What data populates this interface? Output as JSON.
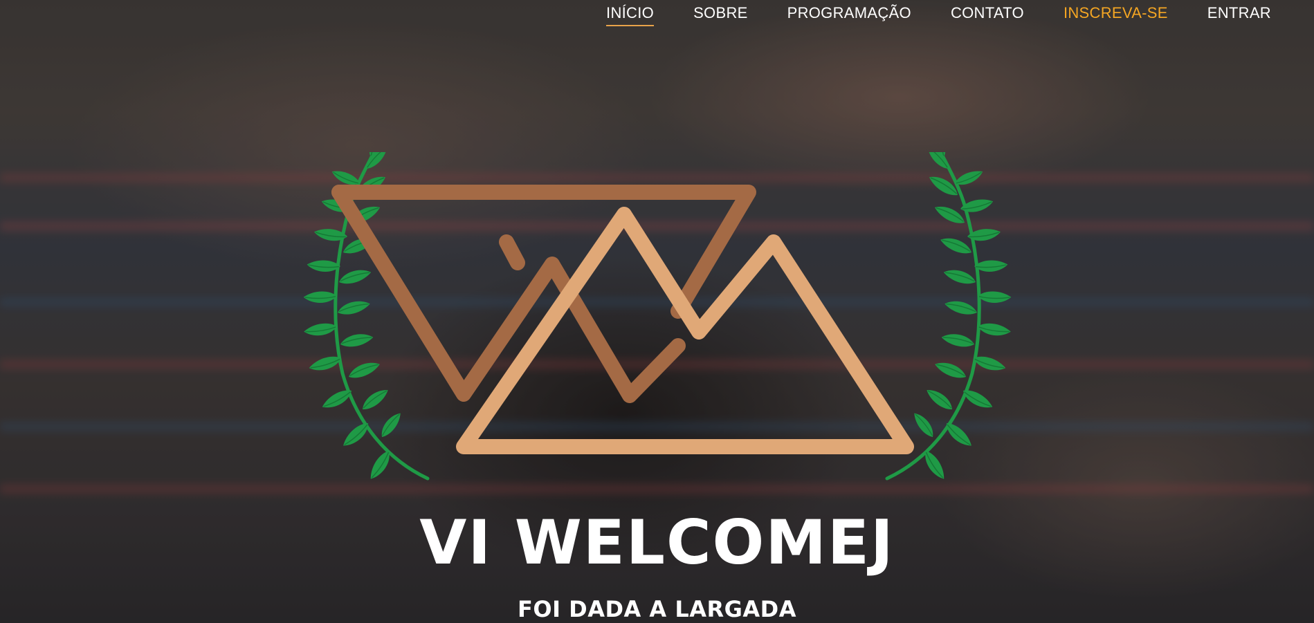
{
  "nav": {
    "items": [
      {
        "label": "INÍCIO"
      },
      {
        "label": "SOBRE"
      },
      {
        "label": "PROGRAMAÇÃO"
      },
      {
        "label": "CONTATO"
      },
      {
        "label": "INSCREVA-SE"
      },
      {
        "label": "ENTRAR"
      }
    ],
    "active_index": 0,
    "cta_index": 4,
    "active_underline_color": "#e8a34a",
    "cta_color": "#f5a623"
  },
  "hero": {
    "title": "VI WELCOMEJ",
    "subtitle": "FOI DADA A LARGADA",
    "background": "blurred swimmers photo under dark overlay"
  },
  "logo": {
    "icon_names": [
      "laurel-wreath-icon",
      "interlocked-triangles-logo-icon"
    ],
    "colors": {
      "laurel": "#1f9a46",
      "triangle_dark": "#a46a45",
      "triangle_light": "#e0a877"
    }
  }
}
